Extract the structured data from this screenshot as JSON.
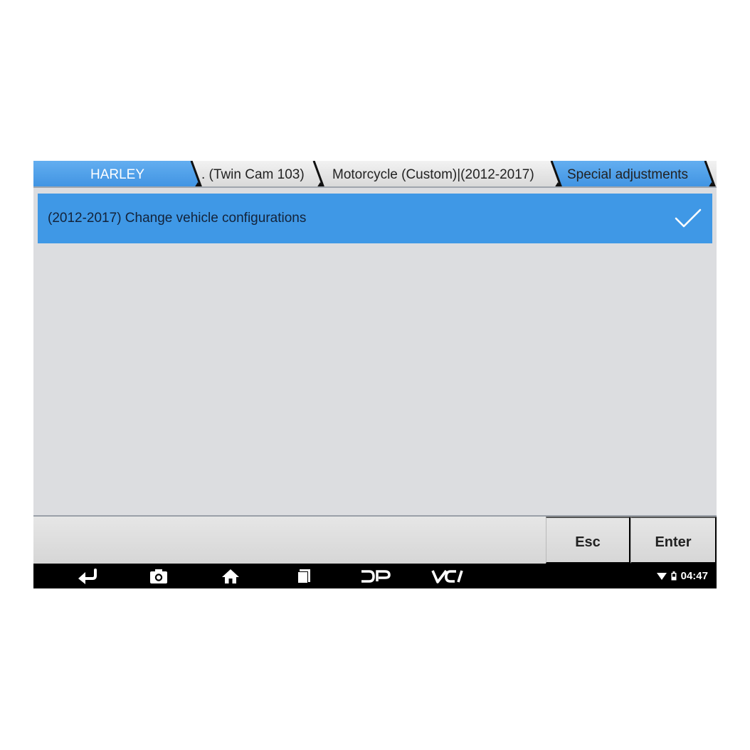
{
  "breadcrumb": {
    "items": [
      {
        "label": "HARLEY"
      },
      {
        "label": ". (Twin Cam 103)"
      },
      {
        "label": "Motorcycle (Custom)|(2012-2017)"
      },
      {
        "label": "Special adjustments"
      }
    ]
  },
  "list": {
    "items": [
      {
        "label": "(2012-2017) Change vehicle configurations",
        "selected": true
      }
    ]
  },
  "actions": {
    "esc_label": "Esc",
    "enter_label": "Enter"
  },
  "nav": {
    "icons": [
      "back-icon",
      "camera-icon",
      "home-icon",
      "recents-icon",
      "dp-icon",
      "vci-icon"
    ],
    "dp_label": "DP",
    "vci_label": "VCI"
  },
  "status": {
    "time": "04:47"
  },
  "colors": {
    "accent": "#3f98e6",
    "active_tab": "#4a9ee8",
    "screen_bg": "#dcdde0",
    "nav_bg": "#000000"
  }
}
